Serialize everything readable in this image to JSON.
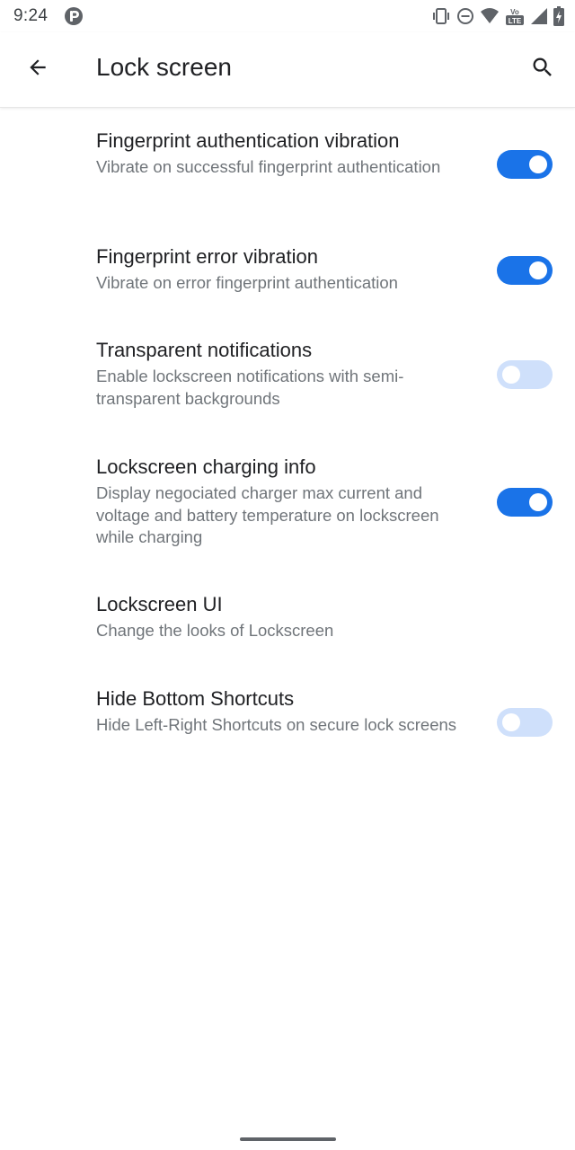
{
  "status_bar": {
    "time": "9:24",
    "icons": [
      "app-notification-icon",
      "vibrate-icon",
      "do-not-disturb-icon",
      "wifi-icon",
      "volte-icon",
      "cell-signal-icon",
      "battery-charging-icon"
    ],
    "volte_label": "Vo LTE"
  },
  "app_bar": {
    "title": "Lock screen",
    "back_icon": "arrow-back-icon",
    "search_icon": "search-icon"
  },
  "preferences": [
    {
      "title": "Fingerprint authentication vibration",
      "summary": "Vibrate on successful fingerprint authentication",
      "switch": "on"
    },
    {
      "title": "Fingerprint error vibration",
      "summary": "Vibrate on error fingerprint authentication",
      "switch": "on"
    },
    {
      "title": "Transparent notifications",
      "summary": "Enable lockscreen notifications with semi-transparent backgrounds",
      "switch": "off"
    },
    {
      "title": "Lockscreen charging info",
      "summary": "Display negociated charger max current and voltage and battery temperature on lockscreen while charging",
      "switch": "on"
    },
    {
      "title": "Lockscreen UI",
      "summary": "Change the looks of Lockscreen",
      "switch": null
    },
    {
      "title": "Hide Bottom Shortcuts",
      "summary": "Hide Left-Right Shortcuts on secure lock screens",
      "switch": "off"
    }
  ],
  "colors": {
    "accent": "#1a73e8",
    "switch_off_track": "#cfe0fb",
    "title_text": "#202124",
    "summary_text": "#70757a"
  }
}
